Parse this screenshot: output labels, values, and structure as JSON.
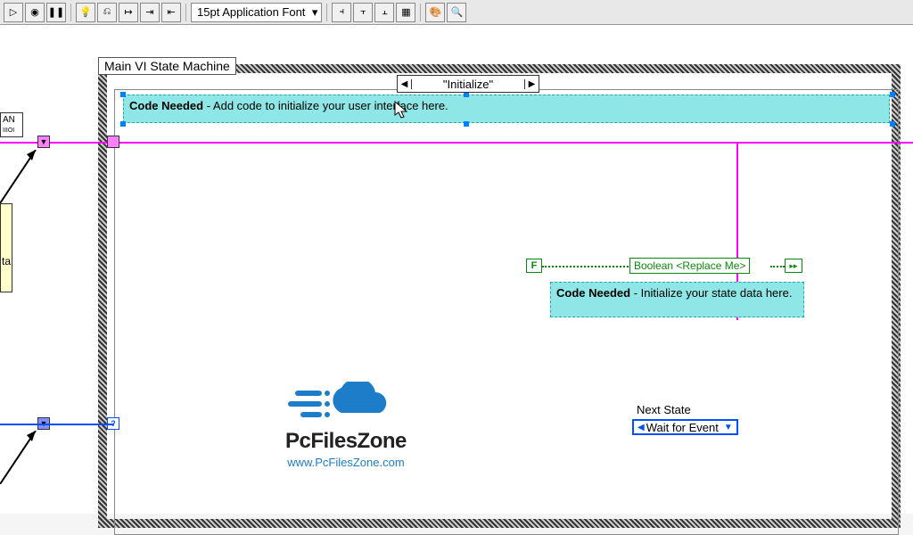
{
  "toolbar": {
    "font_label": "15pt Application Font"
  },
  "diagram": {
    "frame_title": "Main VI State Machine",
    "case_value": "\"Initialize\"",
    "comment_top_bold": "Code Needed",
    "comment_top_rest": " - Add code to initialize your user interface here.",
    "comment_side_bold": "Code Needed",
    "comment_side_rest": " - Initialize your state data here.",
    "bool_const": "F",
    "bool_ind": "Boolean <Replace Me>",
    "next_state_label": "Next State",
    "next_state_value": "Wait for Event",
    "sidebar_text": "ta"
  },
  "watermark": {
    "brand": "PcFilesZone",
    "url": "www.PcFilesZone.com"
  },
  "icons": {
    "run": "▷",
    "abort": "◉",
    "pause": "❚❚",
    "bulb": "💡",
    "retain": "⎌",
    "step": "↦",
    "arr1": "⇥",
    "arr2": "⇤",
    "align1": "⫞",
    "align2": "⫟",
    "align3": "⫠",
    "grid": "▦",
    "palette": "🎨",
    "search": "🔍"
  }
}
